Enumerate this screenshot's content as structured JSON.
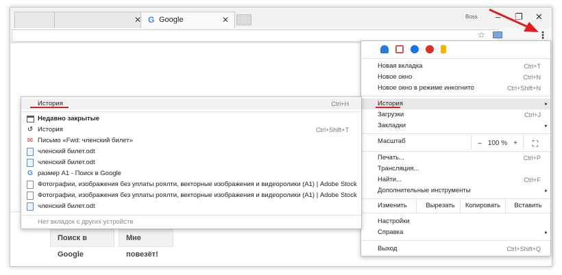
{
  "window": {
    "tabs": [
      {
        "title": ""
      },
      {
        "title": ""
      },
      {
        "title": "Google",
        "favicon": "G"
      }
    ],
    "user": "Boss",
    "controls": {
      "minimize": "–",
      "restore": "❐",
      "close": "✕"
    },
    "close_tab_glyph": "✕"
  },
  "toolbar": {
    "star_glyph": "☆",
    "menu_glyph": "⋮"
  },
  "page": {
    "buttons": {
      "search": "Поиск в Google",
      "lucky": "Мне повезёт!"
    }
  },
  "menu": {
    "extensions": [
      {
        "icon": "cloud-icon",
        "color": "#2a7bd8"
      },
      {
        "icon": "contact-icon",
        "color": "#d9534f"
      },
      {
        "icon": "a-icon",
        "color": "#1a73e8"
      },
      {
        "icon": "puzzle-icon",
        "color": "#d93025"
      },
      {
        "icon": "bookmark-icon",
        "color": "#f4b400"
      }
    ],
    "items": [
      {
        "label": "Новая вкладка",
        "shortcut": "Ctrl+T"
      },
      {
        "label": "Новое окно",
        "shortcut": "Ctrl+N"
      },
      {
        "label": "Новое окно в режиме инкогнито",
        "shortcut": "Ctrl+Shift+N"
      },
      {
        "label": "История",
        "shortcut": "",
        "arrow": "▸"
      },
      {
        "label": "Загрузки",
        "shortcut": "Ctrl+J"
      },
      {
        "label": "Закладки",
        "shortcut": "",
        "arrow": "▸"
      },
      {
        "label": "Печать...",
        "shortcut": "Ctrl+P"
      },
      {
        "label": "Трансляция...",
        "shortcut": ""
      },
      {
        "label": "Найти...",
        "shortcut": "Ctrl+F"
      },
      {
        "label": "Дополнительные инструменты",
        "shortcut": "",
        "arrow": "▸"
      },
      {
        "label": "Настройки",
        "shortcut": ""
      },
      {
        "label": "Справка",
        "shortcut": "",
        "arrow": "▸"
      },
      {
        "label": "Выход",
        "shortcut": "Ctrl+Shift+Q"
      }
    ],
    "zoom": {
      "label": "Масштаб",
      "minus": "–",
      "value": "100 %",
      "plus": "+",
      "fullscreen": "⛶"
    },
    "edit": {
      "label": "Изменить",
      "cut": "Вырезать",
      "copy": "Копировать",
      "paste": "Вставить"
    }
  },
  "history": {
    "header": {
      "label": "История",
      "shortcut": "Ctrl+H"
    },
    "recently_closed": "Недавно закрытые",
    "items": [
      {
        "label": "История",
        "shortcut": "Ctrl+Shift+T",
        "icon": "history-icon"
      },
      {
        "label": "Письмо «Fwd: членский билет»",
        "icon": "mail-icon"
      },
      {
        "label": "членский билет.odt",
        "icon": "document-icon"
      },
      {
        "label": "членский билет.odt",
        "icon": "document-icon"
      },
      {
        "label": "размер A1 - Поиск в Google",
        "icon": "google-icon"
      },
      {
        "label": "Фотографии, изображения без уплаты роялти, векторные изображения и видеоролики (A1) | Adobe Stock",
        "icon": "page-icon"
      },
      {
        "label": "Фотографии, изображения без уплаты роялти, векторные изображения и видеоролики (A1) | Adobe Stock",
        "icon": "page-icon"
      },
      {
        "label": "членский билет.odt",
        "icon": "document-icon"
      }
    ],
    "no_tabs": "Нет вкладок с других устройств"
  },
  "colors": {
    "annotation": "#e11d1d"
  }
}
